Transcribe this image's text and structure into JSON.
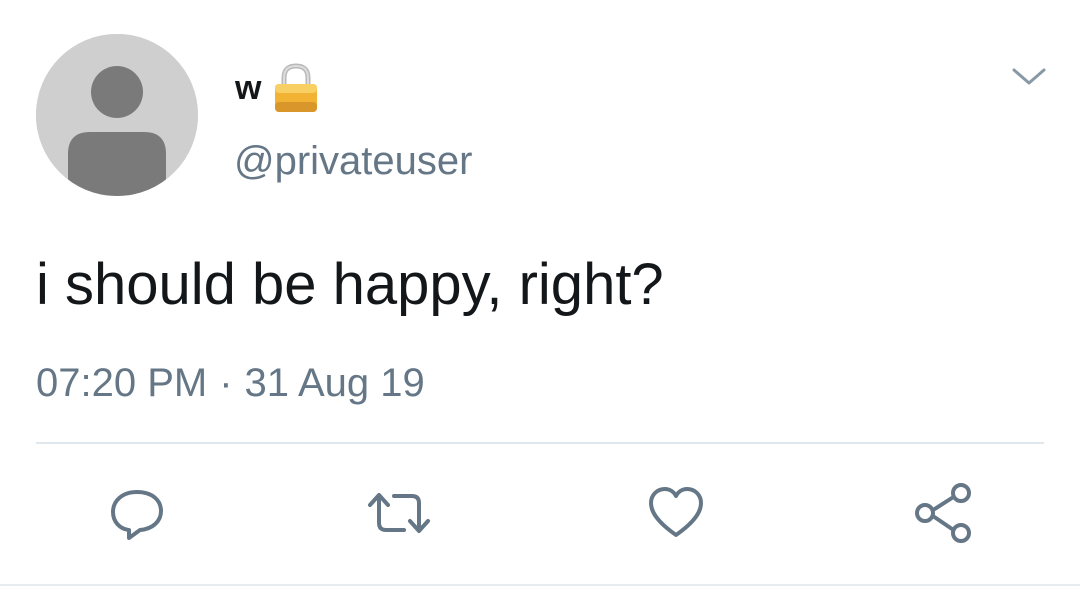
{
  "tweet": {
    "display_name": "w",
    "username": "@privateuser",
    "text": "i should be happy, right?",
    "time": "07:20 PM",
    "separator": "·",
    "date": "31 Aug 19"
  },
  "icons": {
    "lock": "lock-icon",
    "chevron": "chevron-down-icon",
    "reply": "reply-icon",
    "retweet": "retweet-icon",
    "like": "heart-icon",
    "share": "share-icon"
  },
  "colors": {
    "text_primary": "#14171a",
    "text_secondary": "#657786",
    "icon_gray": "#657786",
    "avatar_bg": "#cfcfcf",
    "avatar_figure": "#7a7a7a",
    "divider": "#e1e8ed",
    "lock_gold": "#f2b233"
  }
}
